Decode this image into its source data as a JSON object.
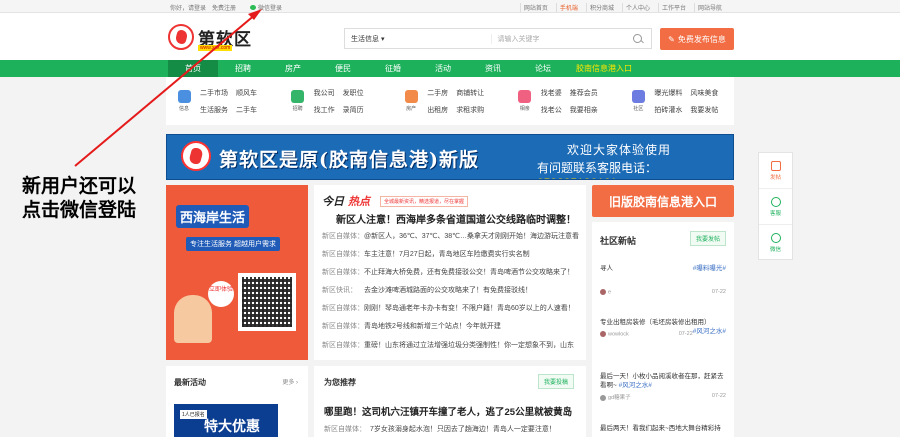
{
  "topbar": {
    "greeting": "你好，请登录",
    "register": "免费注册",
    "wechat_login": "微信登录",
    "right_links": [
      "网站首页",
      "手机端",
      "积分商城",
      "个人中心",
      "工作平台",
      "网站导航"
    ]
  },
  "header": {
    "logo_text": "第软区",
    "logo_url": "www.xxx.com",
    "search_category": "生活信息",
    "search_placeholder": "请输入关键字",
    "post_button": "免费发布信息"
  },
  "nav": {
    "items": [
      "首页",
      "招聘",
      "房产",
      "便民",
      "征婚",
      "活动",
      "资讯",
      "论坛"
    ],
    "special": "胶南信息港入口"
  },
  "categories": [
    {
      "icon_label": "信息",
      "color": "#4a8fe0",
      "links": [
        "二手市场",
        "顺风车",
        "生活服务",
        "二手车"
      ]
    },
    {
      "icon_label": "招聘",
      "color": "#35b56a",
      "links": [
        "我公司",
        "发职位",
        "找工作",
        "录简历"
      ]
    },
    {
      "icon_label": "房产",
      "color": "#f28b4a",
      "links": [
        "二手房",
        "商铺转让",
        "出租房",
        "求租求购"
      ]
    },
    {
      "icon_label": "相亲",
      "color": "#f06080",
      "links": [
        "找老婆",
        "推荐会员",
        "找老公",
        "我要相亲"
      ]
    },
    {
      "icon_label": "社区",
      "color": "#6c7ce0",
      "links": [
        "曝光爆料",
        "风味美食",
        "拍砖灌水",
        "我要发帖"
      ]
    }
  ],
  "banner": {
    "title": "第软区是原(胶南信息港)新版",
    "line1": "欢迎大家体验使用",
    "line2_prefix": "有问题联系客服电话：",
    "phone": "053285186161"
  },
  "promo": {
    "title": "西海岸生活",
    "subtitle": "专注生活服务 超越用户需求",
    "bubble": "立即体验"
  },
  "news": {
    "label_a": "今日",
    "label_b": "热点",
    "subtitle": "全城最新资讯，精选报道，尽在掌握",
    "headline": "新区人注意！西海岸多条省道国道公交线路临时调整！",
    "items": [
      {
        "src": "新区自媒体：",
        "text": "@新区人，36℃、37℃、38℃…桑拿天才刚刚开始！海边游玩注意看"
      },
      {
        "src": "新区自媒体：",
        "text": "车主注意！7月27日起，青岛地区车险缴费实行实名制"
      },
      {
        "src": "新区自媒体：",
        "text": "不止拜海大桥免费，还有免费接驳公交！青岛啤酒节公交攻略来了！"
      },
      {
        "src": "新区快讯：",
        "text": "去金沙滩啤酒城路面的公交攻略来了！有免费接驳线！"
      },
      {
        "src": "新区自媒体：",
        "text": "刚刚！琴岛通老年卡办卡有变！不限户籍！青岛60岁以上的人速看！"
      },
      {
        "src": "新区自媒体：",
        "text": "青岛地铁2号线和新增三个站点！今年就开建"
      },
      {
        "src": "新区自媒体：",
        "text": "重磅！山东将通过立法增强垃圾分类强制性！你一定想象不到，山东"
      }
    ]
  },
  "old_portal_button": "旧版胶南信息港入口",
  "community": {
    "title": "社区新帖",
    "post_button": "我要发帖",
    "posts": [
      {
        "title": "寻人",
        "tag": "#曝料曝光#",
        "author": "e",
        "date": "07-22"
      },
      {
        "title": "专业出租房装修（毛坯房装修出租用）",
        "tag": "#风河之水#",
        "author": "wowlock",
        "date": "07-22"
      },
      {
        "title": "最后一天！小枚小品阅溪收者在那，赶紧去看啊~",
        "tag": "#风河之水#",
        "author": "gd糖果子",
        "date": "07-22"
      },
      {
        "title": "最后两天！看我们起来~西地大舞台精彩持",
        "tag": "",
        "author": "",
        "date": ""
      }
    ]
  },
  "latest": {
    "title": "最新活动",
    "more": "更多",
    "badge": "1人已报名",
    "banner_text": "特大优惠"
  },
  "recommend": {
    "title": "为您推荐",
    "button": "我要投稿",
    "headline": "哪里跑！这司机六汪镇开车撞了老人，逃了25公里就被黄岛",
    "src": "新区自媒体：",
    "text": "7岁女孩溺身起水泡！只因去了趟海边！青岛人一定要注意！"
  },
  "sidebar": [
    "发帖",
    "客服",
    "微信"
  ],
  "annotation": {
    "line1": "新用户还可以",
    "line2": "点击微信登陆"
  }
}
